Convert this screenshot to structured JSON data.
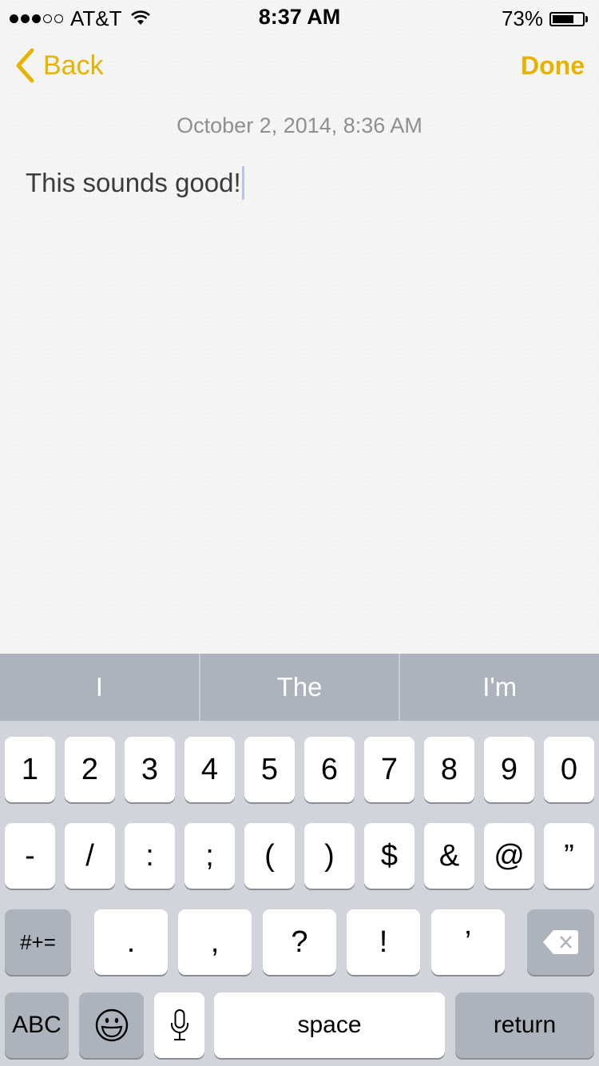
{
  "status_bar": {
    "signal_bars_filled": 3,
    "signal_bars_total": 5,
    "carrier": "AT&T",
    "time": "8:37 AM",
    "battery_percent_label": "73%",
    "battery_level": 0.73
  },
  "nav": {
    "back_label": "Back",
    "done_label": "Done",
    "accent_color": "#e6b400"
  },
  "note": {
    "date": "October 2, 2014, 8:36 AM",
    "body": "This sounds good!"
  },
  "predictions": [
    "I",
    "The",
    "I'm"
  ],
  "keyboard": {
    "row1": [
      "1",
      "2",
      "3",
      "4",
      "5",
      "6",
      "7",
      "8",
      "9",
      "0"
    ],
    "row2": [
      "-",
      "/",
      ":",
      ";",
      "(",
      ")",
      "$",
      "&",
      "@",
      "”"
    ],
    "row3": {
      "shift_label": "#+=",
      "keys": [
        ".",
        ",",
        "?",
        "!",
        "’"
      ],
      "delete_icon": "backspace-icon"
    },
    "row4": {
      "abc_label": "ABC",
      "emoji_icon": "emoji-icon",
      "mic_icon": "microphone-icon",
      "space_label": "space",
      "return_label": "return"
    }
  }
}
